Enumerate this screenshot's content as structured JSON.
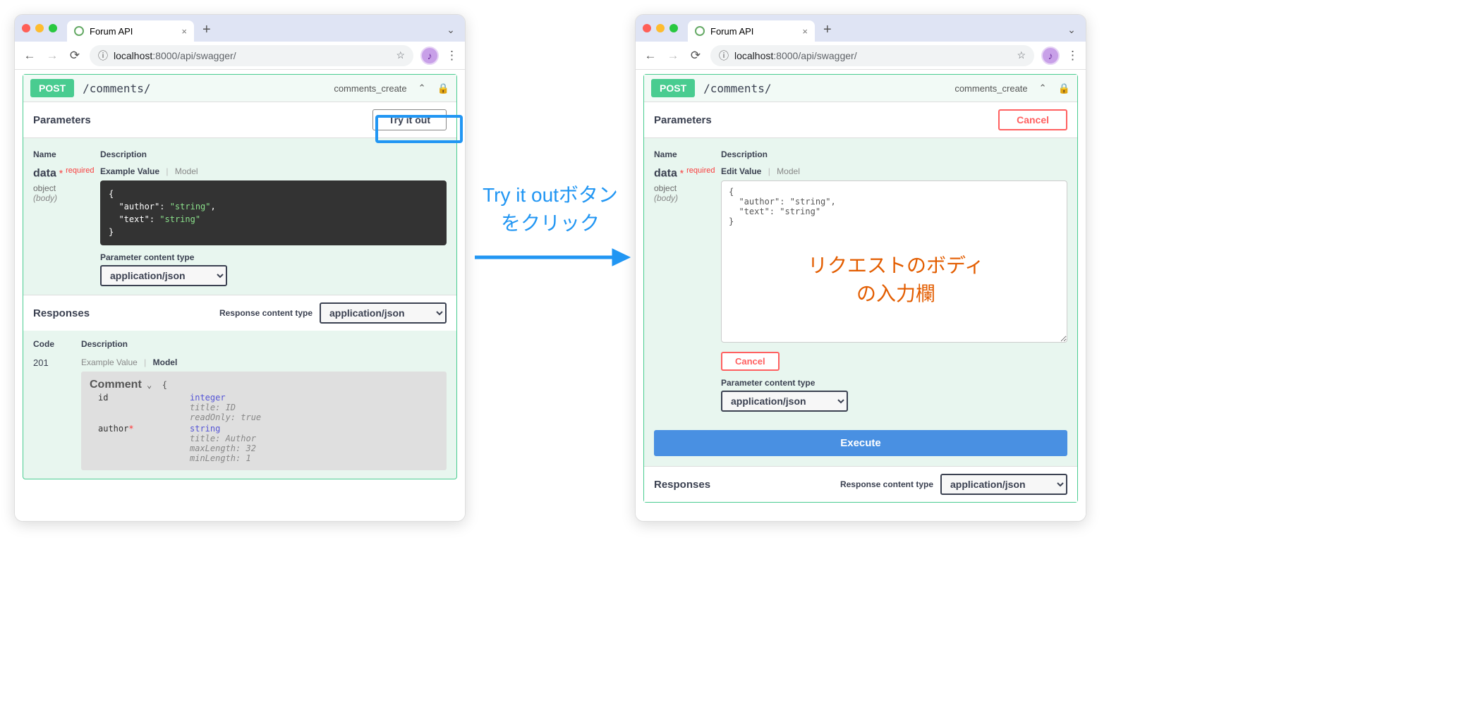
{
  "browser": {
    "tab_title": "Forum API",
    "url_host": "localhost",
    "url_port": ":8000",
    "url_path": "/api/swagger/"
  },
  "left": {
    "method": "POST",
    "path": "/comments/",
    "op_id": "comments_create",
    "parameters_title": "Parameters",
    "try_it_out": "Try it out",
    "col_name": "Name",
    "col_desc": "Description",
    "param_name": "data",
    "required": "required",
    "param_type": "object",
    "param_in": "(body)",
    "example_tab": "Example Value",
    "model_tab": "Model",
    "example_json": "{\n  \"author\": \"string\",\n  \"text\": \"string\"\n}",
    "ctype_label": "Parameter content type",
    "ctype": "application/json",
    "responses_title": "Responses",
    "resp_ctype_label": "Response content type",
    "code_col": "Code",
    "desc_col": "Description",
    "code201": "201",
    "r_example_tab": "Example Value",
    "r_model_tab": "Model",
    "model_name": "Comment",
    "model": {
      "id": {
        "type": "integer",
        "notes": [
          "title: ID",
          "readOnly: true"
        ]
      },
      "author": {
        "type": "string",
        "required": true,
        "notes": [
          "title: Author",
          "maxLength: 32",
          "minLength: 1"
        ]
      }
    }
  },
  "right": {
    "method": "POST",
    "path": "/comments/",
    "op_id": "comments_create",
    "parameters_title": "Parameters",
    "cancel": "Cancel",
    "col_name": "Name",
    "col_desc": "Description",
    "param_name": "data",
    "required": "required",
    "param_type": "object",
    "param_in": "(body)",
    "edit_tab": "Edit Value",
    "model_tab": "Model",
    "edit_json": "{\n  \"author\": \"string\",\n  \"text\": \"string\"\n}",
    "cancel_inline": "Cancel",
    "ctype_label": "Parameter content type",
    "ctype": "application/json",
    "execute": "Execute",
    "responses_title": "Responses",
    "resp_ctype_label": "Response content type"
  },
  "annotations": {
    "click_line1": "Try it outボタン",
    "click_line2": "をクリック",
    "body_line1": "リクエストのボディ",
    "body_line2": "の入力欄"
  }
}
